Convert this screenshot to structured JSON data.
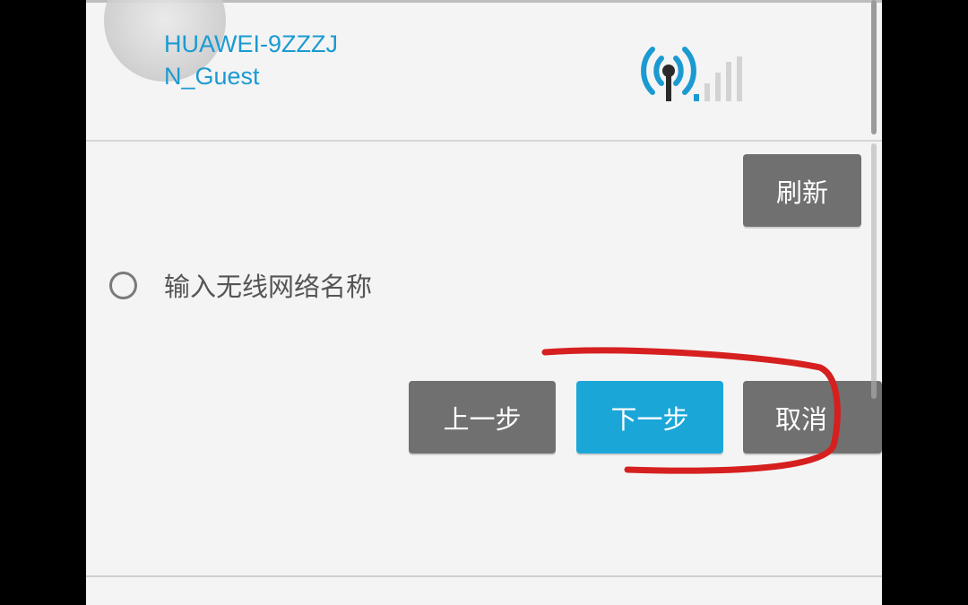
{
  "network": {
    "ssid": "HUAWEI-9ZZZJN_Guest",
    "signal_icon": "wifi-signal-icon",
    "signal_strength_bars": 1
  },
  "buttons": {
    "refresh": "刷新",
    "back": "上一步",
    "next": "下一步",
    "cancel": "取消"
  },
  "manual_entry": {
    "label": "输入无线网络名称",
    "selected": false
  },
  "colors": {
    "accent": "#1ba6d8",
    "button_gray": "#707070",
    "annotation_red": "#d61f1f"
  }
}
